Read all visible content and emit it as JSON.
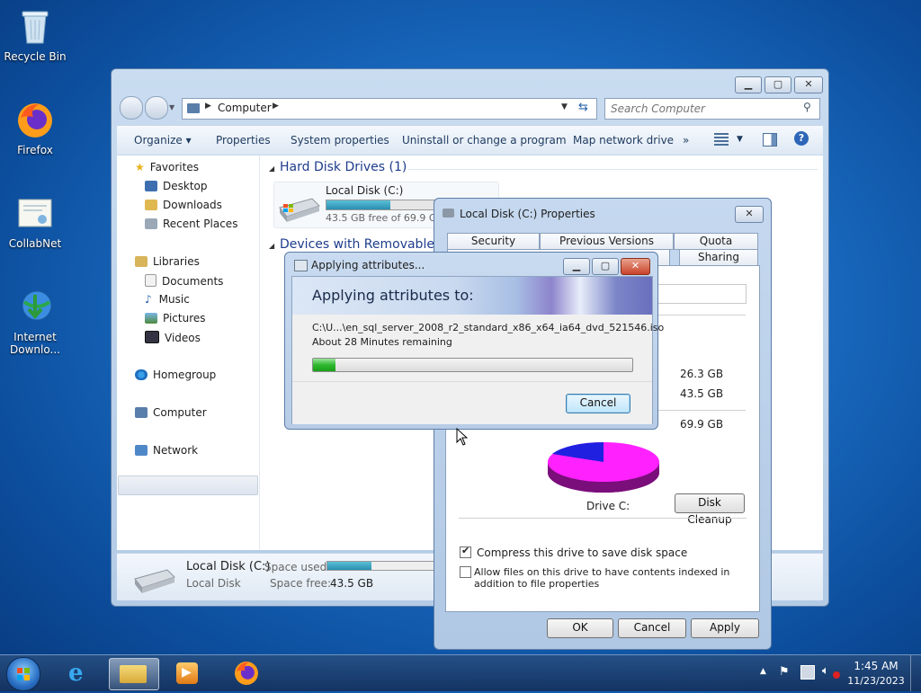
{
  "desktop": {
    "icons": [
      {
        "label": "Recycle Bin"
      },
      {
        "label": "Firefox"
      },
      {
        "label": "CollabNet"
      },
      {
        "label": "Internet Downlo..."
      }
    ]
  },
  "explorer": {
    "address": {
      "crumb": "Computer"
    },
    "search": {
      "placeholder": "Search Computer"
    },
    "toolbar": {
      "organize": "Organize",
      "properties": "Properties",
      "system_properties": "System properties",
      "uninstall": "Uninstall or change a program",
      "map_drive": "Map network drive",
      "more": "»"
    },
    "nav": {
      "favorites": "Favorites",
      "desktop": "Desktop",
      "downloads": "Downloads",
      "recent": "Recent Places",
      "libraries": "Libraries",
      "documents": "Documents",
      "music": "Music",
      "pictures": "Pictures",
      "videos": "Videos",
      "homegroup": "Homegroup",
      "computer": "Computer",
      "network": "Network"
    },
    "content": {
      "hdd_header": "Hard Disk Drives (1)",
      "removable_header": "Devices with Removable S",
      "disk_name": "Local Disk (C:)",
      "disk_free": "43.5 GB free of 69.9 GB",
      "disk_used_fraction": 0.38
    },
    "details": {
      "name": "Local Disk (C:)",
      "type": "Local Disk",
      "space_used_label": "Space used:",
      "space_free_label": "Space free:",
      "space_free_value": "43.5 GB"
    }
  },
  "properties": {
    "title": "Local Disk (C:) Properties",
    "tabs": {
      "security": "Security",
      "previous": "Previous Versions",
      "quota": "Quota",
      "sharing": "Sharing"
    },
    "used_value": "26.3 GB",
    "free_value": "43.5 GB",
    "capacity_value": "69.9 GB",
    "drive_label": "Drive C:",
    "disk_cleanup": "Disk Cleanup",
    "compress_label": "Compress this drive to save disk space",
    "index_label": "Allow files on this drive to have contents indexed in addition to file properties",
    "ok": "OK",
    "cancel": "Cancel",
    "apply": "Apply"
  },
  "applying": {
    "title": "Applying attributes...",
    "heading": "Applying attributes to:",
    "file": "C:\\U...\\en_sql_server_2008_r2_standard_x86_x64_ia64_dvd_521546.iso",
    "remaining": "About 28 Minutes remaining",
    "progress_fraction": 0.07,
    "cancel": "Cancel"
  },
  "taskbar": {
    "time": "1:45 AM",
    "date": "11/23/2023"
  },
  "colors": {
    "pie_used": "#2020e0",
    "pie_free": "#ff22ff",
    "progress_green": "#2fb82f"
  }
}
